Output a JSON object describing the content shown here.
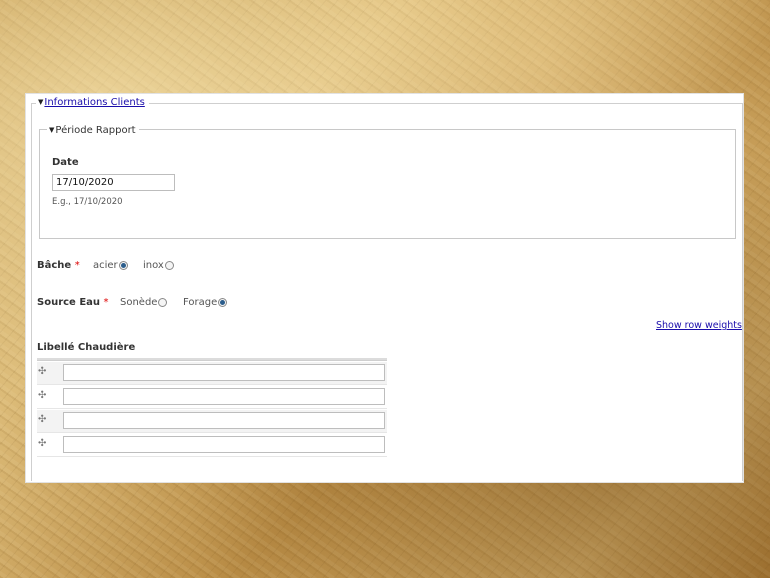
{
  "fieldset_main": {
    "legend": "Informations Clients"
  },
  "fieldset_period": {
    "legend": "Période Rapport",
    "date_label": "Date",
    "date_value": "17/10/2020",
    "date_hint": "E.g., 17/10/2020"
  },
  "bache": {
    "label": "Bâche",
    "required_mark": "*",
    "options": [
      {
        "label": "acier",
        "selected": true
      },
      {
        "label": "inox",
        "selected": false
      }
    ]
  },
  "source_eau": {
    "label": "Source Eau",
    "required_mark": "*",
    "options": [
      {
        "label": "Sonède",
        "selected": false
      },
      {
        "label": "Forage",
        "selected": true
      }
    ]
  },
  "show_row_weights": "Show row weights",
  "chaudiere": {
    "label": "Libellé Chaudière",
    "rows": [
      "",
      "",
      "",
      ""
    ]
  },
  "colors": {
    "link": "#1a0dab",
    "required": "#dd0000",
    "radio_selected": "#2b5d8c"
  }
}
